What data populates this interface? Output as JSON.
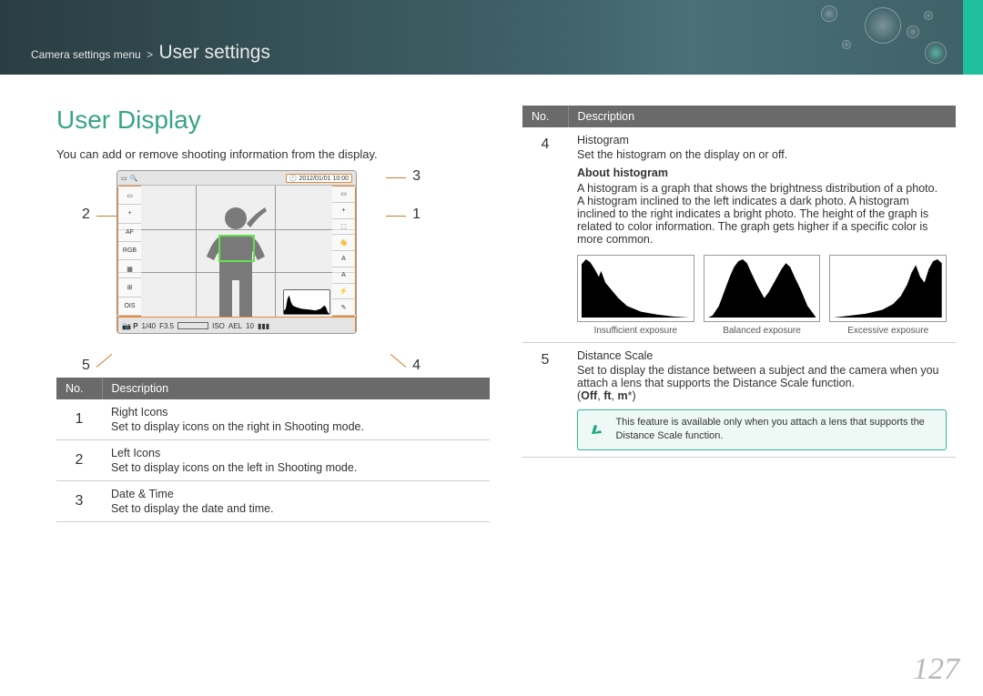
{
  "breadcrumb": {
    "root": "Camera settings menu",
    "sep": ">",
    "leaf": "User settings"
  },
  "heading": "User Display",
  "intro": "You can add or remove shooting information from the display.",
  "camera": {
    "date": "2012/01/01 10:00",
    "bottom": {
      "mode": "P",
      "shutter": "1/40",
      "fnum": "F3.5",
      "iso_label": "ISO",
      "ael": "AEL",
      "shots": "10"
    }
  },
  "callouts": {
    "c1": "1",
    "c2": "2",
    "c3": "3",
    "c4": "4",
    "c5": "5"
  },
  "table_left": {
    "h_no": "No.",
    "h_desc": "Description",
    "r1": {
      "n": "1",
      "t": "Right Icons",
      "d": "Set to display icons on the right in Shooting mode."
    },
    "r2": {
      "n": "2",
      "t": "Left Icons",
      "d": "Set to display icons on the left in Shooting mode."
    },
    "r3": {
      "n": "3",
      "t": "Date & Time",
      "d": "Set to display the date and time."
    }
  },
  "table_right": {
    "h_no": "No.",
    "h_desc": "Description",
    "r4": {
      "n": "4",
      "t": "Histogram",
      "d1": "Set the histogram on the display on or off.",
      "sub": "About histogram",
      "d2": "A histogram is a graph that shows the brightness distribution of a photo. A histogram inclined to the left indicates a dark photo. A histogram inclined to the right indicates a bright photo. The height of the graph is related to color information. The graph gets higher if a specific color is more common.",
      "cap1": "Insufficient exposure",
      "cap2": "Balanced exposure",
      "cap3": "Excessive exposure"
    },
    "r5": {
      "n": "5",
      "t": "Distance Scale",
      "d1": "Set to display the distance between a subject and the camera when you attach a lens that supports the Distance Scale function.",
      "opts_prefix": "(",
      "opts_off": "Off",
      "opts_sep1": ", ",
      "opts_ft": "ft",
      "opts_sep2": ", ",
      "opts_m": "m",
      "opts_star": "*",
      "opts_suffix": ")",
      "note": "This feature is available only when you attach a lens that supports the Distance Scale function."
    }
  },
  "page_number": "127"
}
